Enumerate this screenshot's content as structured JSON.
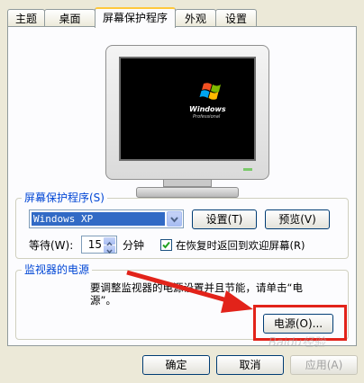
{
  "tabs": [
    {
      "label": "主题"
    },
    {
      "label": "桌面"
    },
    {
      "label": "屏幕保护程序"
    },
    {
      "label": "外观"
    },
    {
      "label": "设置"
    }
  ],
  "active_tab": "屏幕保护程序",
  "monitor": {
    "logo_text": "Windows",
    "logo_sub": "Professional"
  },
  "screensaver": {
    "group_title": "屏幕保护程序(S)",
    "selected": "Windows XP",
    "settings_button": "设置(T)",
    "preview_button": "预览(V)",
    "wait_label": "等待(W):",
    "wait_value": "15",
    "wait_unit": "分钟",
    "resume_checkbox_label": "在恢复时返回到欢迎屏幕(R)",
    "resume_checked": true
  },
  "power": {
    "group_title": "监视器的电源",
    "description_line1": "要调整监视器的电源设置并且节能，请单击“电",
    "description_line2": "源”。",
    "power_button": "电源(O)..."
  },
  "footer": {
    "ok_button": "确定",
    "cancel_button": "取消",
    "apply_button": "应用(A)"
  },
  "watermark_text": "Baidu经验",
  "colors": {
    "arrow": "#E2231A",
    "highlight": "#E2231A",
    "selection": "#316AC5"
  }
}
